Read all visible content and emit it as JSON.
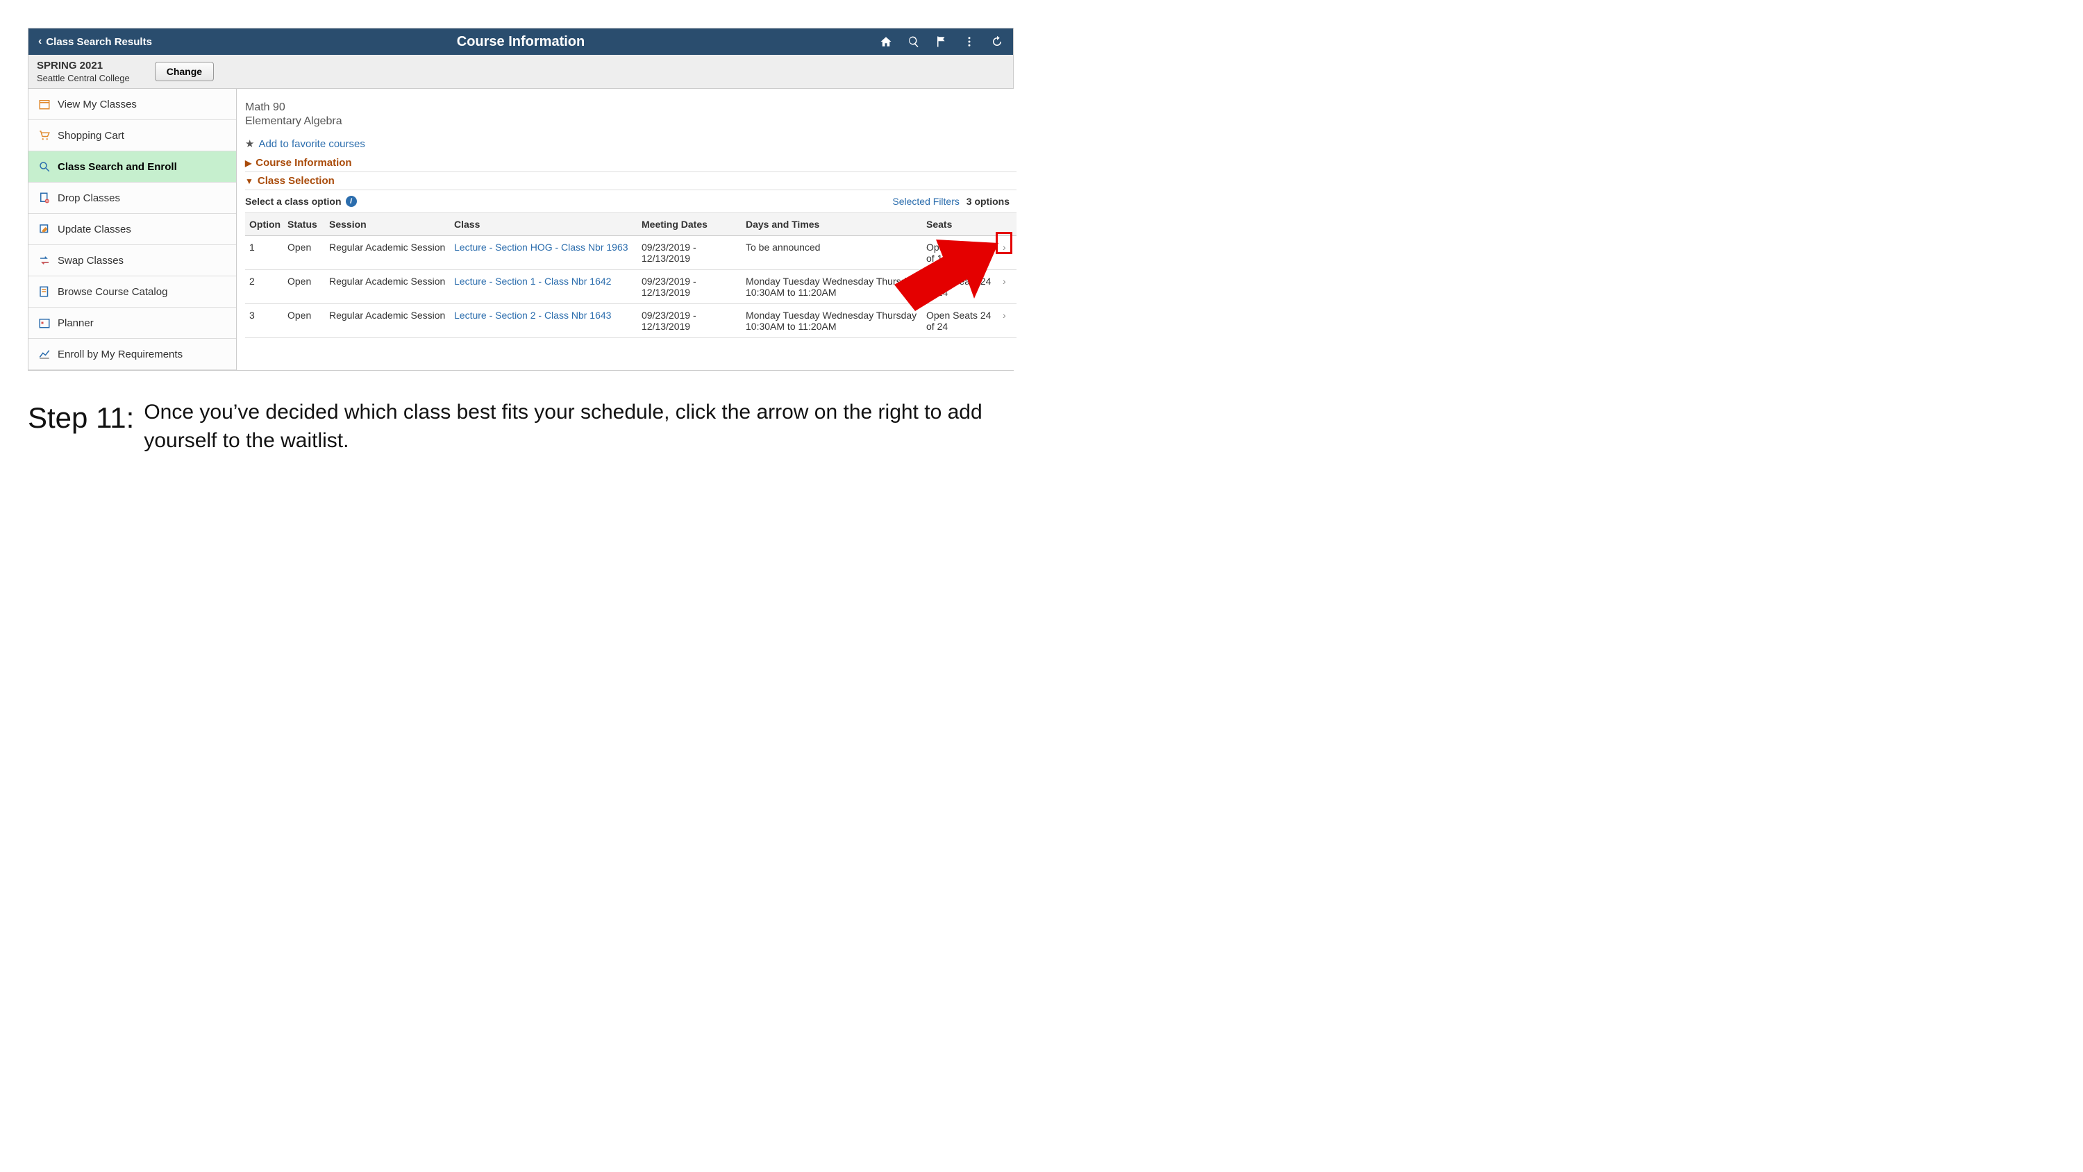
{
  "header": {
    "back_label": "Class Search Results",
    "title": "Course Information"
  },
  "term": {
    "label": "SPRING 2021",
    "institution": "Seattle Central College",
    "change_label": "Change"
  },
  "sidebar": {
    "items": [
      {
        "label": "View My Classes"
      },
      {
        "label": "Shopping Cart"
      },
      {
        "label": "Class Search and Enroll"
      },
      {
        "label": "Drop Classes"
      },
      {
        "label": "Update Classes"
      },
      {
        "label": "Swap Classes"
      },
      {
        "label": "Browse Course Catalog"
      },
      {
        "label": "Planner"
      },
      {
        "label": "Enroll by My Requirements"
      }
    ]
  },
  "course": {
    "code": "Math 90",
    "name": "Elementary Algebra",
    "add_favorite": "Add to favorite courses",
    "course_info_head": "Course Information",
    "class_selection_head": "Class Selection",
    "select_label": "Select a class option",
    "selected_filters_label": "Selected Filters",
    "options_count": "3 options"
  },
  "table": {
    "headers": {
      "option": "Option",
      "status": "Status",
      "session": "Session",
      "class": "Class",
      "meeting": "Meeting Dates",
      "days": "Days and Times",
      "seats": "Seats"
    },
    "rows": [
      {
        "option": "1",
        "status": "Open",
        "session": "Regular Academic Session",
        "class": "Lecture - Section HOG - Class Nbr 1963",
        "meeting": "09/23/2019 - 12/13/2019",
        "days": "To be announced",
        "seats": "Open Seats 10 of 10"
      },
      {
        "option": "2",
        "status": "Open",
        "session": "Regular Academic Session",
        "class": "Lecture - Section 1 - Class Nbr 1642",
        "meeting": "09/23/2019 - 12/13/2019",
        "days": "Monday Tuesday Wednesday Thursday\n10:30AM to 11:20AM",
        "seats": "Open Seats 24 of 24"
      },
      {
        "option": "3",
        "status": "Open",
        "session": "Regular Academic Session",
        "class": "Lecture - Section 2 - Class Nbr 1643",
        "meeting": "09/23/2019 - 12/13/2019",
        "days": "Monday Tuesday Wednesday Thursday\n10:30AM to 11:20AM",
        "seats": "Open Seats 24 of 24"
      }
    ]
  },
  "caption": {
    "step": "Step 11:",
    "text": "Once you’ve decided which class best fits your schedule, click the arrow on the right to add yourself to the waitlist."
  }
}
